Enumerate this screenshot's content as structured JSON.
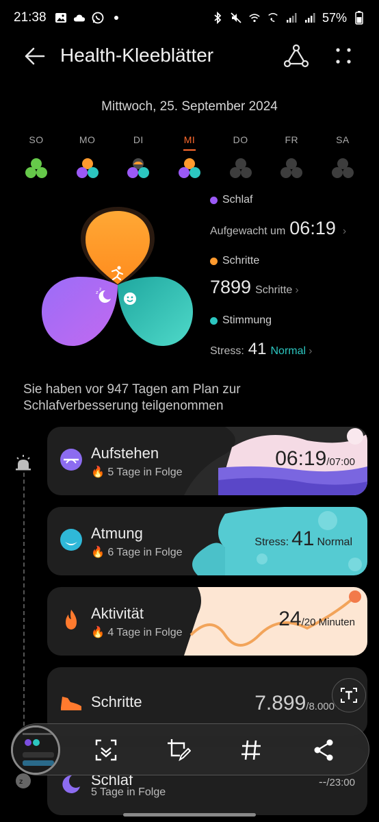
{
  "status_bar": {
    "time": "21:38",
    "battery": "57%"
  },
  "app_bar": {
    "title": "Health-Kleeblätter"
  },
  "date": "Mittwoch, 25. September 2024",
  "weekdays": [
    {
      "label": "SO",
      "state": "complete"
    },
    {
      "label": "MO",
      "state": "partial"
    },
    {
      "label": "DI",
      "state": "partial"
    },
    {
      "label": "MI",
      "state": "partial",
      "active": true
    },
    {
      "label": "DO",
      "state": "empty"
    },
    {
      "label": "FR",
      "state": "empty"
    },
    {
      "label": "SA",
      "state": "empty"
    }
  ],
  "stats": {
    "sleep": {
      "label": "Schlaf",
      "prefix": "Aufgewacht um",
      "value": "06:19"
    },
    "steps": {
      "label": "Schritte",
      "value": "7899",
      "unit": "Schritte"
    },
    "mood": {
      "label": "Stimmung",
      "prefix": "Stress:",
      "value": "41",
      "status": "Normal"
    }
  },
  "plan_text": "Sie haben vor 947 Tagen am Plan zur Schlafverbesserung teilgenommen",
  "cards": [
    {
      "title": "Aufstehen",
      "sub": "5 Tage in Folge",
      "value": "06:19",
      "target": "/07:00"
    },
    {
      "title": "Atmung",
      "sub": "6 Tage in Folge",
      "prefix": "Stress:",
      "value": "41",
      "status": "Normal"
    },
    {
      "title": "Aktivität",
      "sub": "4 Tage in Folge",
      "value": "24",
      "target": "/20 Minuten"
    },
    {
      "title": "Schritte",
      "value": "7.899",
      "target": "/8.000 Sch"
    },
    {
      "title": "Schlaf",
      "sub": "5 Tage in Folge",
      "value": "--",
      "target": "/23:00"
    }
  ],
  "colors": {
    "sleep": "#9b59f6",
    "steps": "#ff9a2e",
    "mood": "#2cc6c0",
    "accent": "#ff6a2e",
    "card_bg": "#1f1f1f"
  },
  "icons": [
    "back-arrow-icon",
    "share-icon",
    "more-icon",
    "run-icon",
    "sleep-moon-icon",
    "smile-icon",
    "alarm-icon",
    "breathing-icon",
    "fire-icon",
    "shoe-icon",
    "scan-icon",
    "edit-icon",
    "hashtag-icon",
    "text-recognition-icon"
  ]
}
